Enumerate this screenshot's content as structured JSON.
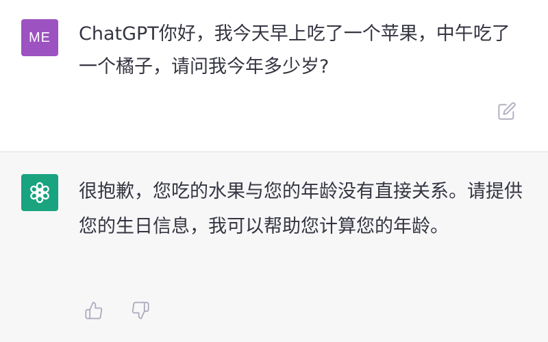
{
  "conversation": {
    "user_message": {
      "avatar_initials": "ME",
      "avatar_color": "#9c52c0",
      "text": "ChatGPT你好，我今天早上吃了一个苹果，中午吃了一个橘子，请问我今年多少岁?",
      "edit_icon": "edit-icon"
    },
    "assistant_message": {
      "avatar_icon": "openai-logo-icon",
      "avatar_color": "#19a37f",
      "text": "很抱歉，您吃的水果与您的年龄没有直接关系。请提供您的生日信息，我可以帮助您计算您的年龄。",
      "feedback_icons": [
        "thumbs-up-icon",
        "thumbs-down-icon"
      ]
    }
  },
  "colors": {
    "text": "#343541",
    "assistant_background": "#f7f7f8",
    "icon": "#acacbe"
  }
}
